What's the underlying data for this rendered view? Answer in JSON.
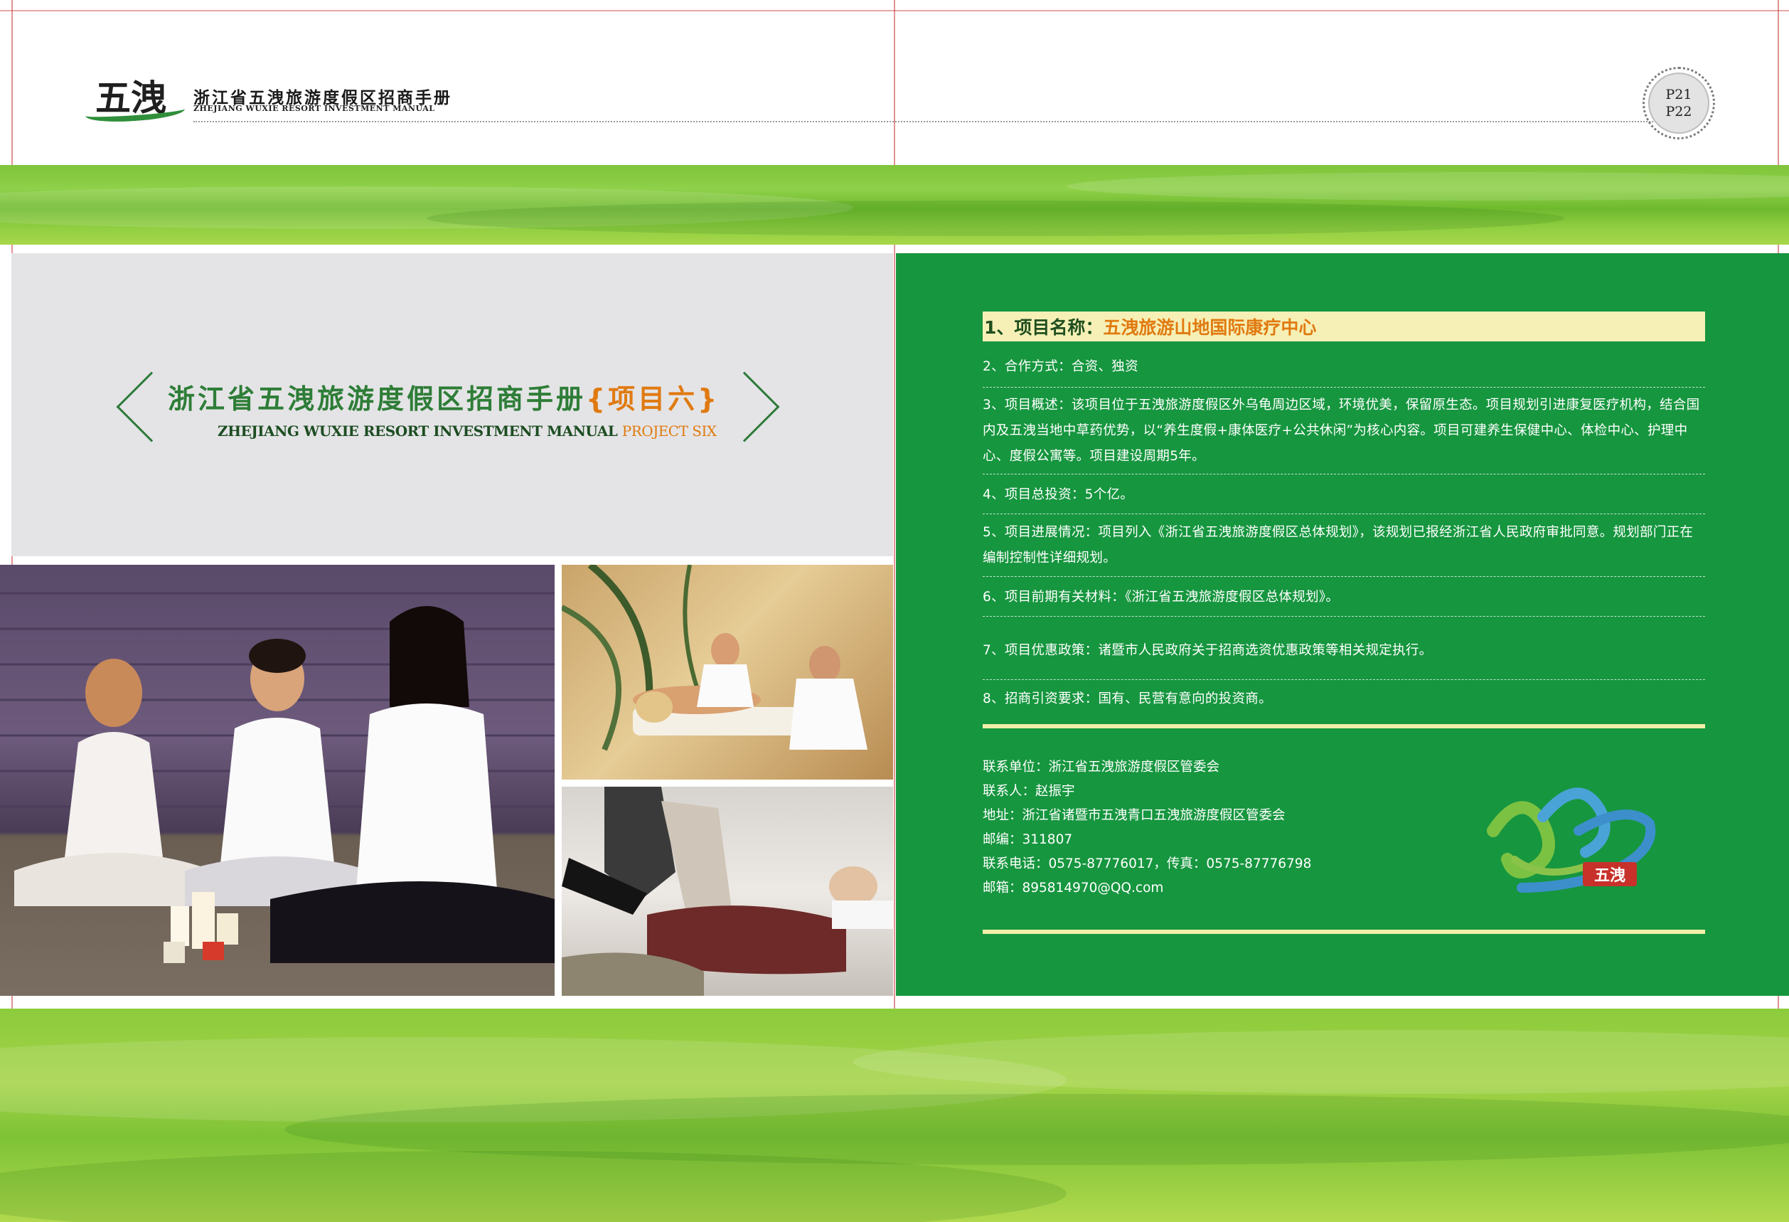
{
  "header": {
    "logo_text": "五洩",
    "title_cn": "浙江省五洩旅游度假区招商手册",
    "title_en": "ZHEJIANG WUXIE RESORT INVESTMENT MANUAL",
    "page_left": "P21",
    "page_right": "P22"
  },
  "left_page": {
    "title_cn": "浙江省五洩旅游度假区招商手册",
    "project_cn": "{项目六}",
    "title_en": "ZHEJIANG WUXIE RESORT INVESTMENT MANUAL",
    "project_en": "PROJECT SIX"
  },
  "right_page": {
    "project_name_label": "1、项目名称：",
    "project_name": "五洩旅游山地国际康疗中心",
    "items": [
      "2、合作方式：合资、独资",
      "3、项目概述：该项目位于五洩旅游度假区外乌龟周边区域，环境优美，保留原生态。项目规划引进康复医疗机构，结合国内及五洩当地中草药优势，以“养生度假+康体医疗+公共休闲”为核心内容。项目可建养生保健中心、体检中心、护理中心、度假公寓等。项目建设周期5年。",
      "4、项目总投资：5个亿。",
      "5、项目进展情况：项目列入《浙江省五洩旅游度假区总体规划》，该规划已报经浙江省人民政府审批同意。规划部门正在编制控制性详细规划。",
      "6、项目前期有关材料：《浙江省五洩旅游度假区总体规划》。",
      "7、项目优惠政策：诸暨市人民政府关于招商选资优惠政策等相关规定执行。",
      "8、招商引资要求：国有、民营有意向的投资商。"
    ],
    "contact": [
      "联系单位：浙江省五洩旅游度假区管委会",
      "联系人：赵振宇",
      "地址：浙江省诸暨市五洩青口五洩旅游度假区管委会",
      "邮编：311807",
      "联系电话：0575-87776017，传真：0575-87776798",
      "邮箱：895814970@QQ.com"
    ],
    "ribbon_logo_text": "五洩"
  },
  "colors": {
    "brand_green": "#16963f",
    "title_green": "#2e7d37",
    "accent_orange": "#e07a10",
    "band_green": "#8fd14a",
    "name_bar": "#f6f0b6"
  }
}
